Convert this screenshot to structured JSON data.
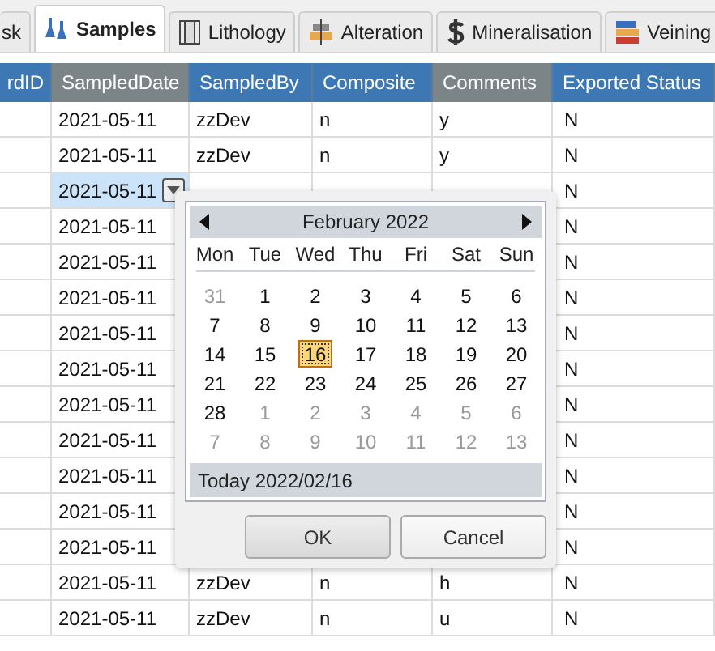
{
  "tabs": [
    {
      "label": "sk",
      "selected": false
    },
    {
      "label": "Samples",
      "selected": true
    },
    {
      "label": "Lithology",
      "selected": false
    },
    {
      "label": "Alteration",
      "selected": false
    },
    {
      "label": "Mineralisation",
      "selected": false
    },
    {
      "label": "Veining",
      "selected": false
    }
  ],
  "table": {
    "columns": [
      {
        "label": "rdID",
        "sorted": false
      },
      {
        "label": "SampledDate",
        "sorted": true
      },
      {
        "label": "SampledBy",
        "sorted": false
      },
      {
        "label": "Composite",
        "sorted": false
      },
      {
        "label": "Comments",
        "sorted": true
      },
      {
        "label": "Exported Status",
        "sorted": false
      }
    ],
    "rows": [
      {
        "selected": false,
        "cells": [
          "",
          "2021-05-11",
          "zzDev",
          "n",
          "y",
          "N"
        ]
      },
      {
        "selected": false,
        "cells": [
          "",
          "2021-05-11",
          "zzDev",
          "n",
          "y",
          "N"
        ]
      },
      {
        "selected": true,
        "cells": [
          "",
          "2021-05-11",
          "",
          "",
          "",
          "N"
        ]
      },
      {
        "selected": false,
        "cells": [
          "",
          "2021-05-11",
          "",
          "",
          "",
          "N"
        ]
      },
      {
        "selected": false,
        "cells": [
          "",
          "2021-05-11",
          "",
          "",
          "",
          "N"
        ]
      },
      {
        "selected": false,
        "cells": [
          "",
          "2021-05-11",
          "",
          "",
          "",
          "N"
        ]
      },
      {
        "selected": false,
        "cells": [
          "",
          "2021-05-11",
          "",
          "",
          "",
          "N"
        ]
      },
      {
        "selected": false,
        "cells": [
          "",
          "2021-05-11",
          "",
          "",
          "",
          "N"
        ]
      },
      {
        "selected": false,
        "cells": [
          "",
          "2021-05-11",
          "",
          "",
          "",
          "N"
        ]
      },
      {
        "selected": false,
        "cells": [
          "",
          "2021-05-11",
          "",
          "",
          "",
          "N"
        ]
      },
      {
        "selected": false,
        "cells": [
          "",
          "2021-05-11",
          "",
          "",
          "",
          "N"
        ]
      },
      {
        "selected": false,
        "cells": [
          "",
          "2021-05-11",
          "",
          "",
          "",
          "N"
        ]
      },
      {
        "selected": false,
        "cells": [
          "",
          "2021-05-11",
          "",
          "",
          "",
          "N"
        ]
      },
      {
        "selected": false,
        "cells": [
          "",
          "2021-05-11",
          "zzDev",
          "n",
          "h",
          "N"
        ]
      },
      {
        "selected": false,
        "cells": [
          "",
          "2021-05-11",
          "zzDev",
          "n",
          "u",
          "N"
        ]
      }
    ]
  },
  "date_picker": {
    "month": "February 2022",
    "weekdays": [
      "Mon",
      "Tue",
      "Wed",
      "Thu",
      "Fri",
      "Sat",
      "Sun"
    ],
    "weeks": [
      [
        {
          "day": "31",
          "in_month": false,
          "selected": false
        },
        {
          "day": "1",
          "in_month": true,
          "selected": false
        },
        {
          "day": "2",
          "in_month": true,
          "selected": false
        },
        {
          "day": "3",
          "in_month": true,
          "selected": false
        },
        {
          "day": "4",
          "in_month": true,
          "selected": false
        },
        {
          "day": "5",
          "in_month": true,
          "selected": false
        },
        {
          "day": "6",
          "in_month": true,
          "selected": false
        }
      ],
      [
        {
          "day": "7",
          "in_month": true,
          "selected": false
        },
        {
          "day": "8",
          "in_month": true,
          "selected": false
        },
        {
          "day": "9",
          "in_month": true,
          "selected": false
        },
        {
          "day": "10",
          "in_month": true,
          "selected": false
        },
        {
          "day": "11",
          "in_month": true,
          "selected": false
        },
        {
          "day": "12",
          "in_month": true,
          "selected": false
        },
        {
          "day": "13",
          "in_month": true,
          "selected": false
        }
      ],
      [
        {
          "day": "14",
          "in_month": true,
          "selected": false
        },
        {
          "day": "15",
          "in_month": true,
          "selected": false
        },
        {
          "day": "16",
          "in_month": true,
          "selected": true
        },
        {
          "day": "17",
          "in_month": true,
          "selected": false
        },
        {
          "day": "18",
          "in_month": true,
          "selected": false
        },
        {
          "day": "19",
          "in_month": true,
          "selected": false
        },
        {
          "day": "20",
          "in_month": true,
          "selected": false
        }
      ],
      [
        {
          "day": "21",
          "in_month": true,
          "selected": false
        },
        {
          "day": "22",
          "in_month": true,
          "selected": false
        },
        {
          "day": "23",
          "in_month": true,
          "selected": false
        },
        {
          "day": "24",
          "in_month": true,
          "selected": false
        },
        {
          "day": "25",
          "in_month": true,
          "selected": false
        },
        {
          "day": "26",
          "in_month": true,
          "selected": false
        },
        {
          "day": "27",
          "in_month": true,
          "selected": false
        }
      ],
      [
        {
          "day": "28",
          "in_month": true,
          "selected": false
        },
        {
          "day": "1",
          "in_month": false,
          "selected": false
        },
        {
          "day": "2",
          "in_month": false,
          "selected": false
        },
        {
          "day": "3",
          "in_month": false,
          "selected": false
        },
        {
          "day": "4",
          "in_month": false,
          "selected": false
        },
        {
          "day": "5",
          "in_month": false,
          "selected": false
        },
        {
          "day": "6",
          "in_month": false,
          "selected": false
        }
      ],
      [
        {
          "day": "7",
          "in_month": false,
          "selected": false
        },
        {
          "day": "8",
          "in_month": false,
          "selected": false
        },
        {
          "day": "9",
          "in_month": false,
          "selected": false
        },
        {
          "day": "10",
          "in_month": false,
          "selected": false
        },
        {
          "day": "11",
          "in_month": false,
          "selected": false
        },
        {
          "day": "12",
          "in_month": false,
          "selected": false
        },
        {
          "day": "13",
          "in_month": false,
          "selected": false
        }
      ]
    ],
    "today": "Today 2022/02/16",
    "buttons": [
      "OK",
      "Cancel"
    ]
  }
}
